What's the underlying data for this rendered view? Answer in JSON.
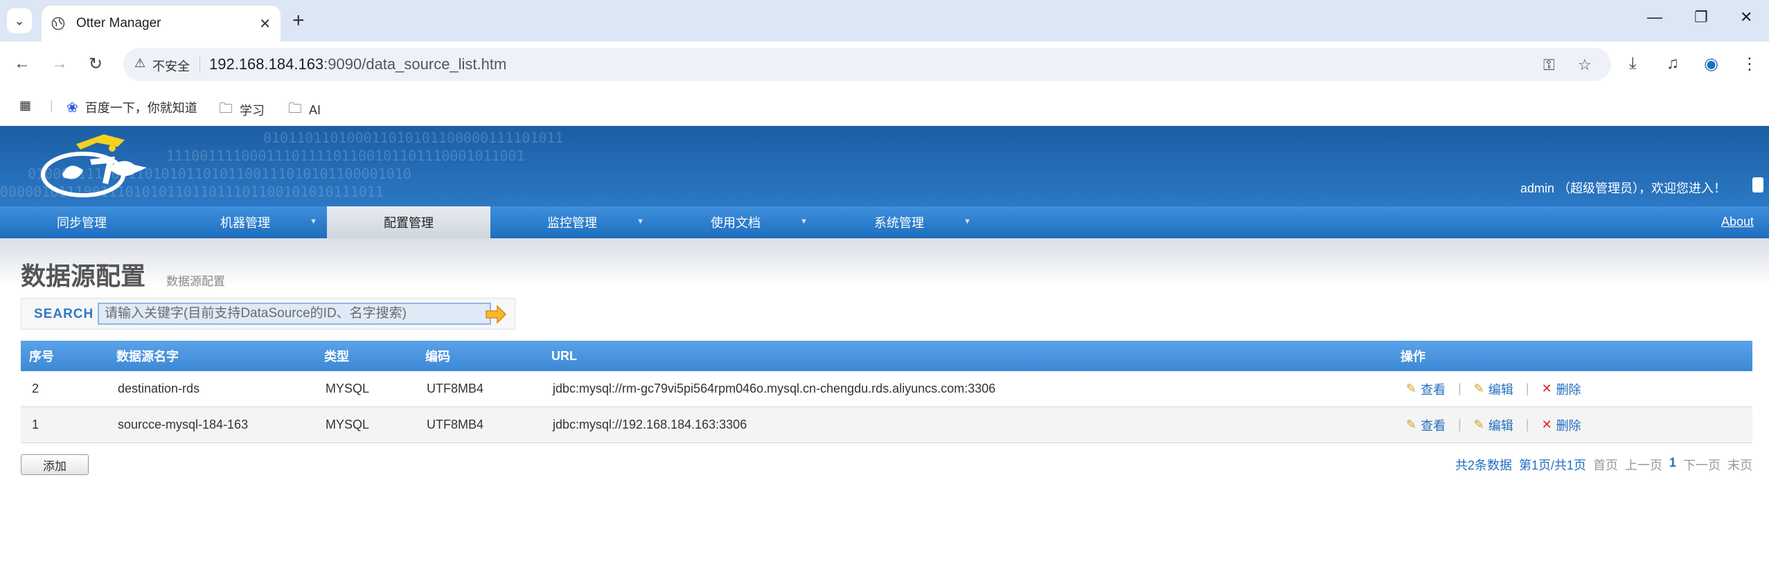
{
  "browser": {
    "tab_title": "Otter Manager",
    "url_host": "192.168.184.163",
    "url_rest": ":9090/data_source_list.htm",
    "insecure_label": "不安全",
    "bookmarks": [
      {
        "label": "百度一下，你就知道",
        "icon": "paw-icon"
      },
      {
        "label": "学习",
        "icon": "folder-icon"
      },
      {
        "label": "AI",
        "icon": "folder-icon"
      }
    ]
  },
  "header": {
    "welcome": "admin （超级管理员），欢迎您进入！"
  },
  "menu": {
    "items": [
      {
        "label": "同步管理",
        "dropdown": false,
        "active": false
      },
      {
        "label": "机器管理",
        "dropdown": true,
        "active": false
      },
      {
        "label": "配置管理",
        "dropdown": false,
        "active": true
      },
      {
        "label": "监控管理",
        "dropdown": true,
        "active": false
      },
      {
        "label": "使用文档",
        "dropdown": true,
        "active": false
      },
      {
        "label": "系统管理",
        "dropdown": true,
        "active": false
      }
    ],
    "about": "About"
  },
  "page": {
    "title": "数据源配置",
    "subtitle": "数据源配置"
  },
  "search": {
    "label": "SEARCH",
    "placeholder": "请输入关键字(目前支持DataSource的ID、名字搜索)"
  },
  "table": {
    "headers": [
      "序号",
      "数据源名字",
      "类型",
      "编码",
      "URL",
      "操作"
    ],
    "rows": [
      {
        "id": "2",
        "name": "destination-rds",
        "type": "MYSQL",
        "encoding": "UTF8MB4",
        "url": "jdbc:mysql://rm-gc79vi5pi564rpm046o.mysql.cn-chengdu.rds.aliyuncs.com:3306"
      },
      {
        "id": "1",
        "name": "sourcce-mysql-184-163",
        "type": "MYSQL",
        "encoding": "UTF8MB4",
        "url": "jdbc:mysql://192.168.184.163:3306"
      }
    ],
    "ops": {
      "view": "查看",
      "edit": "编辑",
      "delete": "删除",
      "sep": "|"
    }
  },
  "footer": {
    "add_label": "添加",
    "total": "共2条数据",
    "page_info": "第1页/共1页",
    "first": "首页",
    "prev": "上一页",
    "current": "1",
    "next": "下一页",
    "last": "末页"
  },
  "colors": {
    "header_blue": "#1b5fa5",
    "menu_blue": "#2f7fd0",
    "link_blue": "#1f6fc0",
    "delete_red": "#dd2222"
  }
}
